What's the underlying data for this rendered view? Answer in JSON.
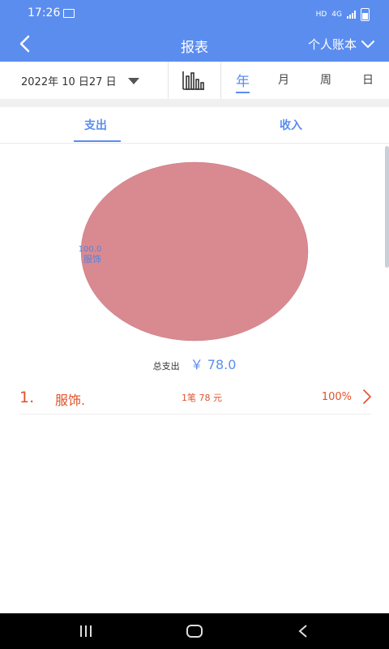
{
  "status": {
    "time": "17:26",
    "hd": "HD",
    "net": "4G"
  },
  "header": {
    "title": "报表",
    "account": "个人账本"
  },
  "filter": {
    "date": "2022年 10 日27 日",
    "periods": [
      "年",
      "月",
      "周",
      "日"
    ],
    "active_period": "年"
  },
  "tabs": [
    {
      "label": "支出",
      "active": true
    },
    {
      "label": "收入",
      "active": false
    }
  ],
  "summary": {
    "total_label": "总支出",
    "total_value": "￥ 78.0"
  },
  "chart_data": {
    "type": "pie",
    "slices": [
      {
        "label": "服饰",
        "value": 100.0,
        "display": "100.0",
        "color": "#d98a90"
      }
    ]
  },
  "items": [
    {
      "index": "1.",
      "name": "服饰.",
      "count": "1笔 78 元",
      "percent": "100%"
    }
  ],
  "colors": {
    "primary": "#5b8def",
    "accent": "#e0522b",
    "slice": "#d98a90"
  }
}
